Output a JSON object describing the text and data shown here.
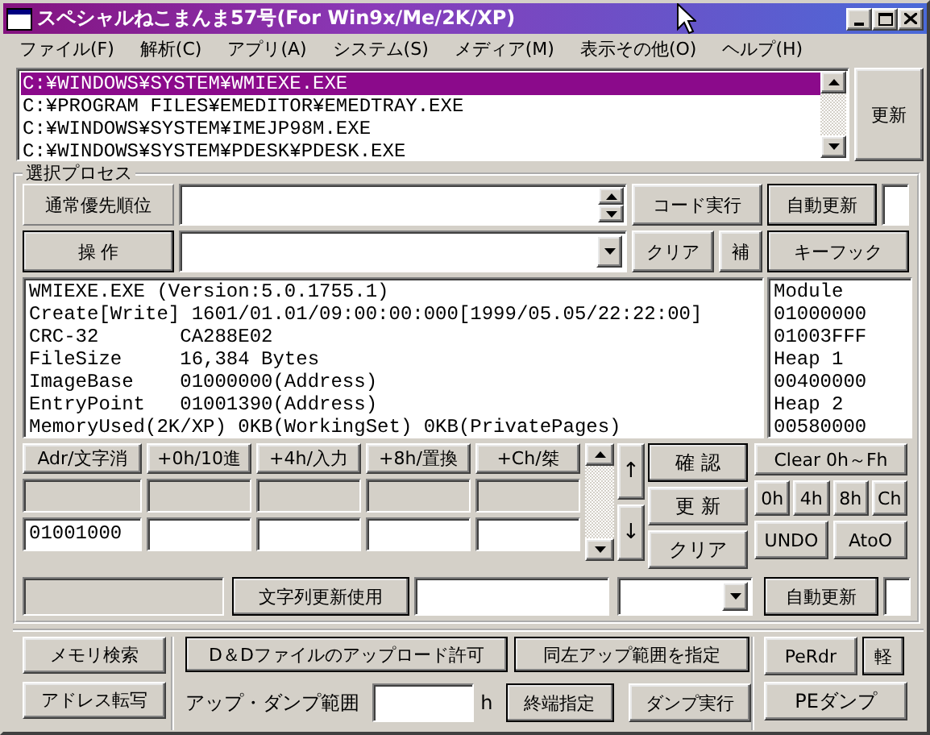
{
  "window": {
    "title": "スペシャルねこまんま57号(For Win9x/Me/2K/XP)"
  },
  "menu": [
    {
      "label": "ファイル(F)"
    },
    {
      "label": "解析(C)"
    },
    {
      "label": "アプリ(A)"
    },
    {
      "label": "システム(S)"
    },
    {
      "label": "メディア(M)"
    },
    {
      "label": "表示その他(O)"
    },
    {
      "label": "ヘルプ(H)"
    }
  ],
  "process_list": {
    "items": [
      {
        "path": "C:¥WINDOWS¥SYSTEM¥WMIEXE.EXE",
        "selected": true
      },
      {
        "path": "C:¥PROGRAM FILES¥EMEDITOR¥EMEDTRAY.EXE",
        "selected": false
      },
      {
        "path": "C:¥WINDOWS¥SYSTEM¥IMEJP98M.EXE",
        "selected": false
      },
      {
        "path": "C:¥WINDOWS¥SYSTEM¥PDESK¥PDESK.EXE",
        "selected": false
      }
    ],
    "refresh_button": "更新"
  },
  "process_group": {
    "label": "選択プロセス",
    "priority_button": "通常優先順位",
    "operate_button": "操 作",
    "code_button": "コード実行",
    "auto_update_button": "自動更新",
    "clear_button": "クリア",
    "supplement_button": "補",
    "key_hook_button": "キーフック",
    "info_lines": [
      "WMIEXE.EXE (Version:5.0.1755.1)",
      "Create[Write] 1601/01.01/09:00:00:000[1999/05.05/22:22:00]",
      "CRC-32       CA288E02",
      "FileSize     16,384 Bytes",
      "ImageBase    01000000(Address)",
      "EntryPoint   01001390(Address)",
      "MemoryUsed(2K/XP) 0KB(WorkingSet) 0KB(PrivatePages)"
    ],
    "memory_map": [
      "Module",
      "01000000",
      "01003FFF",
      "Heap 1",
      "00400000",
      "Heap 2",
      "00580000"
    ]
  },
  "memory_editor": {
    "columns": [
      {
        "header": "Adr/文字消",
        "value": "01001000"
      },
      {
        "header": "+0h/10進"
      },
      {
        "header": "+4h/入力"
      },
      {
        "header": "+8h/置換"
      },
      {
        "header": "+Ch/桀"
      }
    ],
    "up_button": "↑",
    "down_button": "↓",
    "confirm_button": "確 認",
    "update_button": "更 新",
    "clear_button": "クリア",
    "clear_all_button": "Clear 0h～Fh",
    "offset_buttons": [
      "0h",
      "4h",
      "8h",
      "Ch"
    ],
    "undo_button": "UNDO",
    "a_to_o_button": "AtoO",
    "string_update_button": "文字列更新使用",
    "auto_update_button": "自動更新"
  },
  "bottom": {
    "memory_search_button": "メモリ検索",
    "address_copy_button": "アドレス転写",
    "dd_upload_button": "D＆Dファイルのアップロード許可",
    "same_range_button": "同左アップ範囲を指定",
    "range_label": "アップ・ダンプ範囲",
    "range_unit": "h",
    "end_button": "終端指定",
    "dump_button": "ダンプ実行",
    "perdr_button": "PeRdr",
    "light_button": "軽",
    "pe_dump_button": "PEダンプ"
  }
}
